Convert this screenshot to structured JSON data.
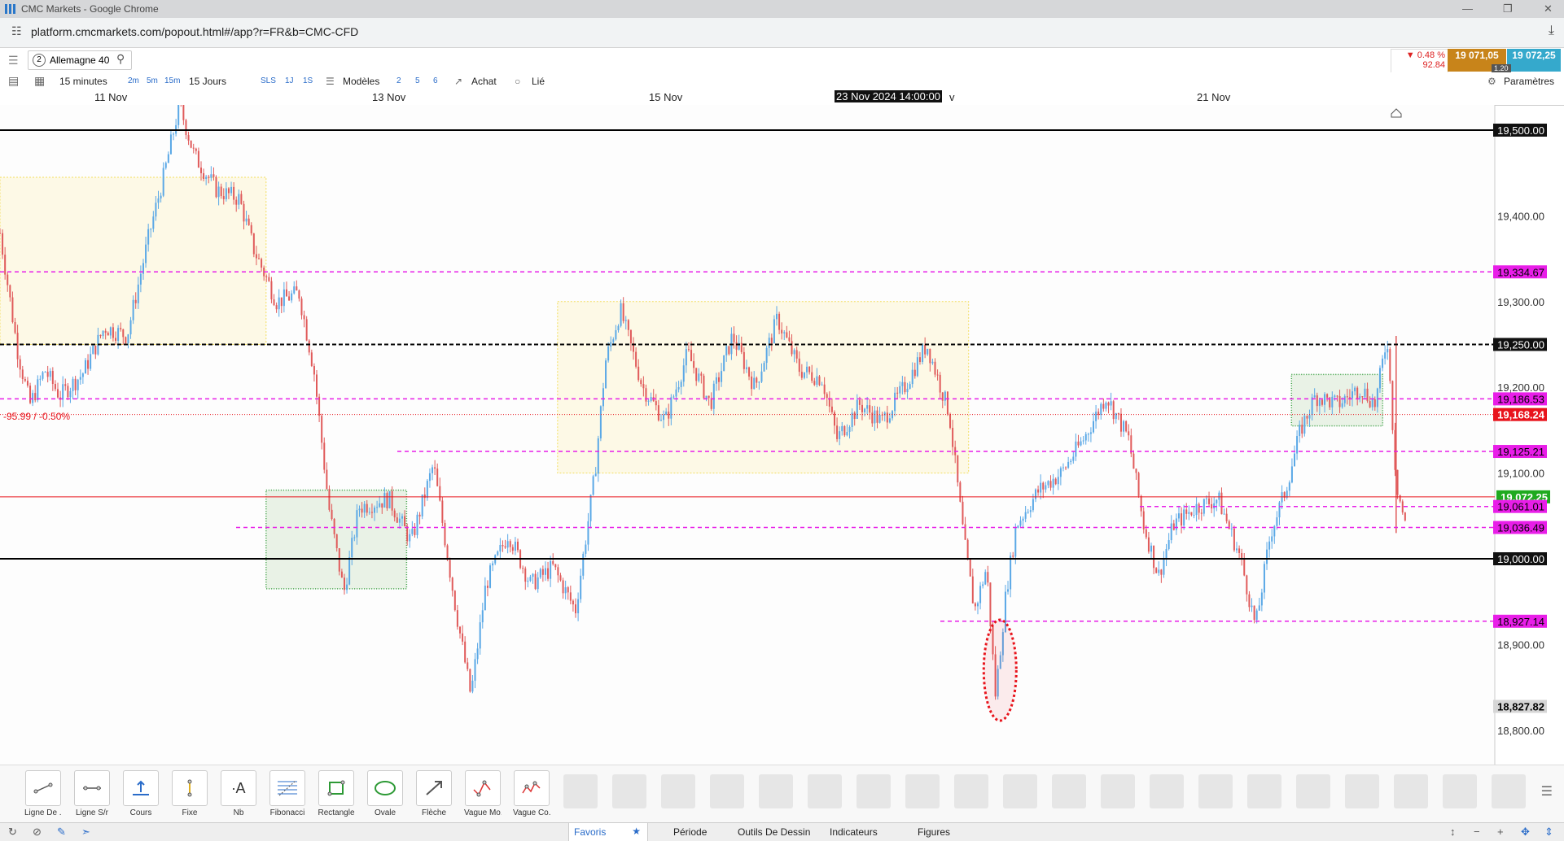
{
  "window": {
    "title": "CMC Markets - Google Chrome"
  },
  "browser": {
    "url": "platform.cmcmarkets.com/popout.html#/app?r=FR&b=CMC-CFD"
  },
  "header": {
    "instrument_number": "2",
    "instrument_name": "Allemagne 40",
    "change_pct": "▼ 0.48 %",
    "change_pts": "92.84",
    "sell_price": "19 071,05",
    "buy_price": "19 072,25",
    "spread": "1.20"
  },
  "toolbar": {
    "interval": "15 minutes",
    "interval_buttons": [
      "2m",
      "5m",
      "15m"
    ],
    "range": "15 Jours",
    "range_buttons": [
      "SLS",
      "1J",
      "1S"
    ],
    "templates": "Modèles",
    "chart_count_buttons": [
      "2",
      "5",
      "6"
    ],
    "buy": "Achat",
    "linked": "Lié",
    "settings": "Paramètres"
  },
  "date_axis": {
    "labels": [
      "11 Nov",
      "13 Nov",
      "15 Nov",
      "21 Nov"
    ],
    "crosshair_label": "23 Nov 2024 14:00:00",
    "crosshair_suffix": "v"
  },
  "colors": {
    "up": "#5aa8e6",
    "down": "#e05a5a",
    "magenta": "#e81ee8",
    "yellow_zone": "#f3dd5c",
    "green_zone": "#2e9a36",
    "price_red": "#e8141c",
    "price_green": "#1faa1f"
  },
  "chart_data": {
    "type": "candlestick",
    "y_axis_ticks": [
      "19,400.00",
      "19,300.00",
      "19,200.00",
      "19,100.00",
      "18,900.00",
      "18,800.00"
    ],
    "ylim": [
      18760,
      19550
    ],
    "change_label": "-95.99 / -0.50%",
    "horizontal_levels": [
      {
        "label": "19,500.00",
        "value": 19500,
        "style": "solid-black"
      },
      {
        "label": "19,334.67",
        "value": 19334.67,
        "style": "dashed-magenta"
      },
      {
        "label": "19,250.00",
        "value": 19250,
        "style": "dashed-black"
      },
      {
        "label": "19,186.53",
        "value": 19186.53,
        "style": "dashed-magenta"
      },
      {
        "label": "19,168.24",
        "value": 19168.24,
        "style": "red-dotted"
      },
      {
        "label": "19,125.21",
        "value": 19125.21,
        "style": "dashed-magenta"
      },
      {
        "label": "19,072.25",
        "value": 19072.25,
        "style": "green-current"
      },
      {
        "label": "19,061.01",
        "value": 19061.01,
        "style": "dashed-magenta"
      },
      {
        "label": "19,036.49",
        "value": 19036.49,
        "style": "dashed-magenta"
      },
      {
        "label": "19,000.00",
        "value": 19000,
        "style": "solid-black"
      },
      {
        "label": "18,927.14",
        "value": 18927.14,
        "style": "dashed-magenta"
      },
      {
        "label": "18,827.82",
        "value": 18827.82,
        "style": "grey-cursor"
      }
    ],
    "series_path": [
      [
        0.0,
        19380
      ],
      [
        0.012,
        19240
      ],
      [
        0.02,
        19180
      ],
      [
        0.03,
        19220
      ],
      [
        0.04,
        19190
      ],
      [
        0.055,
        19215
      ],
      [
        0.07,
        19270
      ],
      [
        0.085,
        19260
      ],
      [
        0.1,
        19380
      ],
      [
        0.11,
        19450
      ],
      [
        0.12,
        19530
      ],
      [
        0.13,
        19470
      ],
      [
        0.145,
        19430
      ],
      [
        0.16,
        19420
      ],
      [
        0.17,
        19360
      ],
      [
        0.185,
        19300
      ],
      [
        0.2,
        19310
      ],
      [
        0.21,
        19220
      ],
      [
        0.22,
        19060
      ],
      [
        0.23,
        18960
      ],
      [
        0.24,
        19060
      ],
      [
        0.26,
        19070
      ],
      [
        0.275,
        19020
      ],
      [
        0.29,
        19110
      ],
      [
        0.305,
        18940
      ],
      [
        0.315,
        18840
      ],
      [
        0.325,
        18970
      ],
      [
        0.34,
        19030
      ],
      [
        0.355,
        18970
      ],
      [
        0.37,
        18990
      ],
      [
        0.385,
        18940
      ],
      [
        0.398,
        19100
      ],
      [
        0.405,
        19230
      ],
      [
        0.415,
        19290
      ],
      [
        0.43,
        19200
      ],
      [
        0.445,
        19160
      ],
      [
        0.46,
        19240
      ],
      [
        0.475,
        19180
      ],
      [
        0.49,
        19260
      ],
      [
        0.505,
        19200
      ],
      [
        0.52,
        19280
      ],
      [
        0.535,
        19220
      ],
      [
        0.55,
        19210
      ],
      [
        0.56,
        19140
      ],
      [
        0.575,
        19180
      ],
      [
        0.59,
        19160
      ],
      [
        0.605,
        19200
      ],
      [
        0.62,
        19250
      ],
      [
        0.635,
        19170
      ],
      [
        0.645,
        19020
      ],
      [
        0.652,
        18940
      ],
      [
        0.66,
        18990
      ],
      [
        0.666,
        18840
      ],
      [
        0.673,
        18960
      ],
      [
        0.68,
        19040
      ],
      [
        0.695,
        19080
      ],
      [
        0.71,
        19100
      ],
      [
        0.725,
        19140
      ],
      [
        0.74,
        19190
      ],
      [
        0.755,
        19140
      ],
      [
        0.765,
        19040
      ],
      [
        0.775,
        18980
      ],
      [
        0.785,
        19040
      ],
      [
        0.8,
        19060
      ],
      [
        0.815,
        19070
      ],
      [
        0.83,
        19000
      ],
      [
        0.84,
        18920
      ],
      [
        0.85,
        19030
      ],
      [
        0.86,
        19080
      ],
      [
        0.87,
        19150
      ],
      [
        0.88,
        19190
      ],
      [
        0.895,
        19180
      ],
      [
        0.91,
        19200
      ],
      [
        0.92,
        19180
      ],
      [
        0.928,
        19260
      ],
      [
        0.934,
        19090
      ],
      [
        0.94,
        19040
      ]
    ],
    "zones": [
      {
        "type": "yellow",
        "x0": 0.0,
        "x1": 0.178,
        "y0": 19250,
        "y1": 19445
      },
      {
        "type": "green",
        "x0": 0.178,
        "x1": 0.272,
        "y0": 18965,
        "y1": 19080
      },
      {
        "type": "yellow",
        "x0": 0.373,
        "x1": 0.648,
        "y0": 19100,
        "y1": 19300
      },
      {
        "type": "green",
        "x0": 0.864,
        "x1": 0.925,
        "y0": 19155,
        "y1": 19215
      }
    ],
    "highlight_ellipse": {
      "x": 0.669,
      "y": 18870
    }
  },
  "drawing_tools": [
    "Ligne De ...",
    "Ligne S/r",
    "Cours",
    "Fixe",
    "Nb",
    "Fibonacci",
    "Rectangle",
    "Ovale",
    "Flèche",
    "Vague Mo...",
    "Vague Co..."
  ],
  "bottom_tabs": [
    "Favoris",
    "Période",
    "Outils De Dessin",
    "Indicateurs",
    "Figures"
  ]
}
